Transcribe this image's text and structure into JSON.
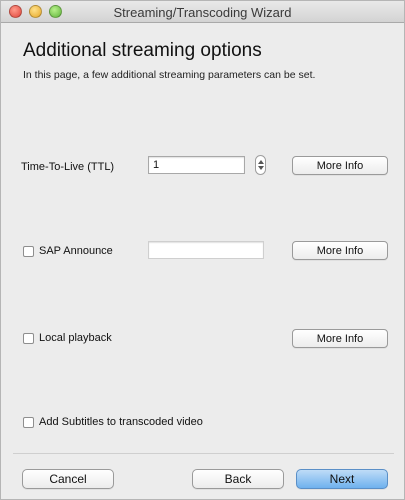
{
  "window": {
    "title": "Streaming/Transcoding Wizard"
  },
  "page": {
    "heading": "Additional streaming options",
    "subheading": "In this page, a few additional streaming parameters can be set."
  },
  "options": {
    "ttl": {
      "label": "Time-To-Live (TTL)",
      "value": "1",
      "more_info": "More Info"
    },
    "sap": {
      "label": "SAP Announce",
      "checked": false,
      "value": "",
      "more_info": "More Info"
    },
    "local_playback": {
      "label": "Local playback",
      "checked": false,
      "more_info": "More Info"
    },
    "subtitles": {
      "label": "Add Subtitles to transcoded video",
      "checked": false
    }
  },
  "footer": {
    "cancel": "Cancel",
    "back": "Back",
    "next": "Next"
  },
  "colors": {
    "primary_button": "#6fb1ee",
    "window_bg": "#ececec"
  }
}
